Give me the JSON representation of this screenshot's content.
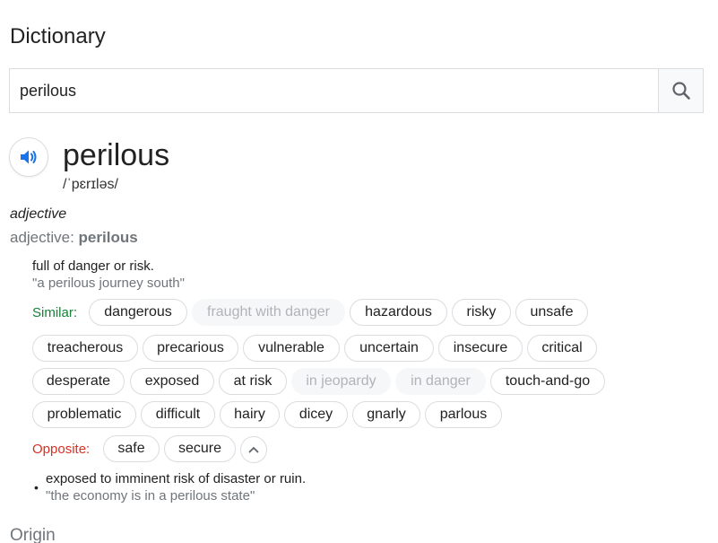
{
  "header": {
    "title": "Dictionary"
  },
  "search": {
    "value": "perilous"
  },
  "entry": {
    "word": "perilous",
    "phonetic": "/ˈpɛrɪləs/",
    "part_of_speech": "adjective",
    "forms_label": "adjective: ",
    "forms_word": "perilous"
  },
  "sense1": {
    "definition": "full of danger or risk.",
    "example": "\"a perilous journey south\""
  },
  "similar": {
    "label": "Similar:",
    "label_color": "#188038",
    "chips": [
      "dangerous",
      "fraught with danger",
      "hazardous",
      "risky",
      "unsafe",
      "treacherous",
      "precarious",
      "vulnerable",
      "uncertain",
      "insecure",
      "critical",
      "desperate",
      "exposed",
      "at risk",
      "in jeopardy",
      "in danger",
      "touch-and-go",
      "problematic",
      "difficult",
      "hairy",
      "dicey",
      "gnarly",
      "parlous"
    ]
  },
  "opposite": {
    "label": "Opposite:",
    "label_color": "#d93025",
    "chips": [
      "safe",
      "secure"
    ]
  },
  "sense2": {
    "definition": "exposed to imminent risk of disaster or ruin.",
    "example": "\"the economy is in a perilous state\""
  },
  "origin": {
    "label": "Origin"
  },
  "icons": {
    "search": "search-icon",
    "speaker": "speaker-icon",
    "collapse": "chevron-up-icon"
  },
  "colors": {
    "accent_blue": "#1a73e8",
    "muted": "#70757a"
  }
}
